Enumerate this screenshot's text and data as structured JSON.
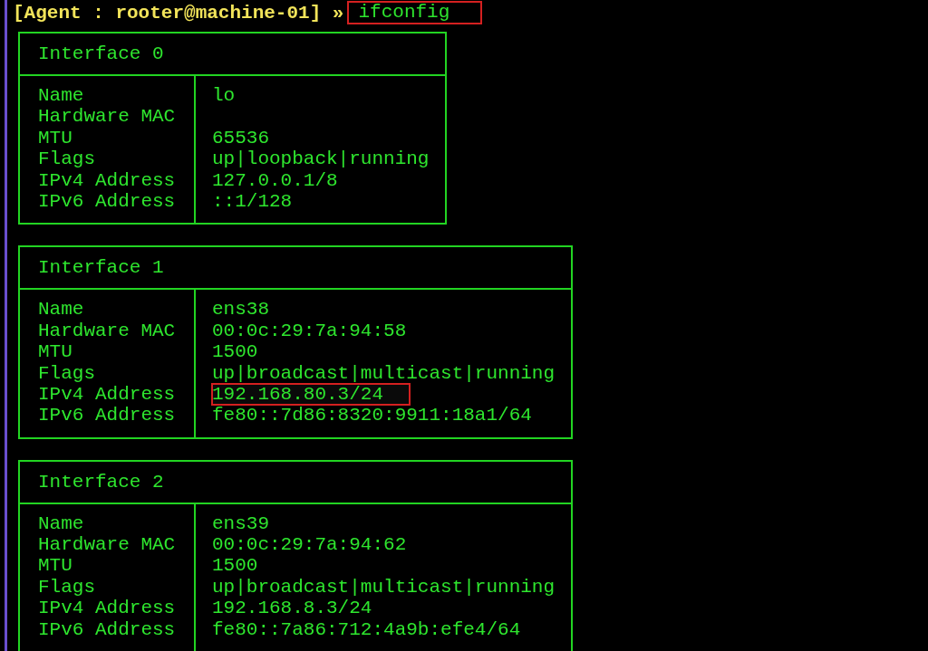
{
  "prompt": {
    "text": "[Agent : rooter@machine-01] »",
    "command": "ifconfig",
    "highlighted": true
  },
  "interfaces": [
    {
      "title": "Interface 0",
      "rows": [
        {
          "label": "Name",
          "value": "lo",
          "highlighted": false
        },
        {
          "label": "Hardware MAC",
          "highlighted": false
        },
        {
          "label": "MTU",
          "value": "65536",
          "highlighted": false
        },
        {
          "label": "Flags",
          "value": "up|loopback|running",
          "highlighted": false
        },
        {
          "label": "IPv4 Address",
          "value": "127.0.0.1/8",
          "highlighted": false
        },
        {
          "label": "IPv6 Address",
          "value": "::1/128",
          "highlighted": false
        }
      ]
    },
    {
      "title": "Interface 1",
      "rows": [
        {
          "label": "Name",
          "value": "ens38",
          "highlighted": false
        },
        {
          "label": "Hardware MAC",
          "value": "00:0c:29:7a:94:58",
          "highlighted": false
        },
        {
          "label": "MTU",
          "value": "1500",
          "highlighted": false
        },
        {
          "label": "Flags",
          "value": "up|broadcast|multicast|running",
          "highlighted": false
        },
        {
          "label": "IPv4 Address",
          "value": "192.168.80.3/24",
          "highlighted": true
        },
        {
          "label": "IPv6 Address",
          "value": "fe80::7d86:8320:9911:18a1/64",
          "highlighted": false
        }
      ]
    },
    {
      "title": "Interface 2",
      "rows": [
        {
          "label": "Name",
          "value": "ens39",
          "highlighted": false
        },
        {
          "label": "Hardware MAC",
          "value": "00:0c:29:7a:94:62",
          "highlighted": false
        },
        {
          "label": "MTU",
          "value": "1500",
          "highlighted": false
        },
        {
          "label": "Flags",
          "value": "up|broadcast|multicast|running",
          "highlighted": false
        },
        {
          "label": "IPv4 Address",
          "value": "192.168.8.3/24",
          "highlighted": false
        },
        {
          "label": "IPv6 Address",
          "value": "fe80::7a86:712:4a9b:efe4/64",
          "highlighted": false
        }
      ]
    }
  ]
}
